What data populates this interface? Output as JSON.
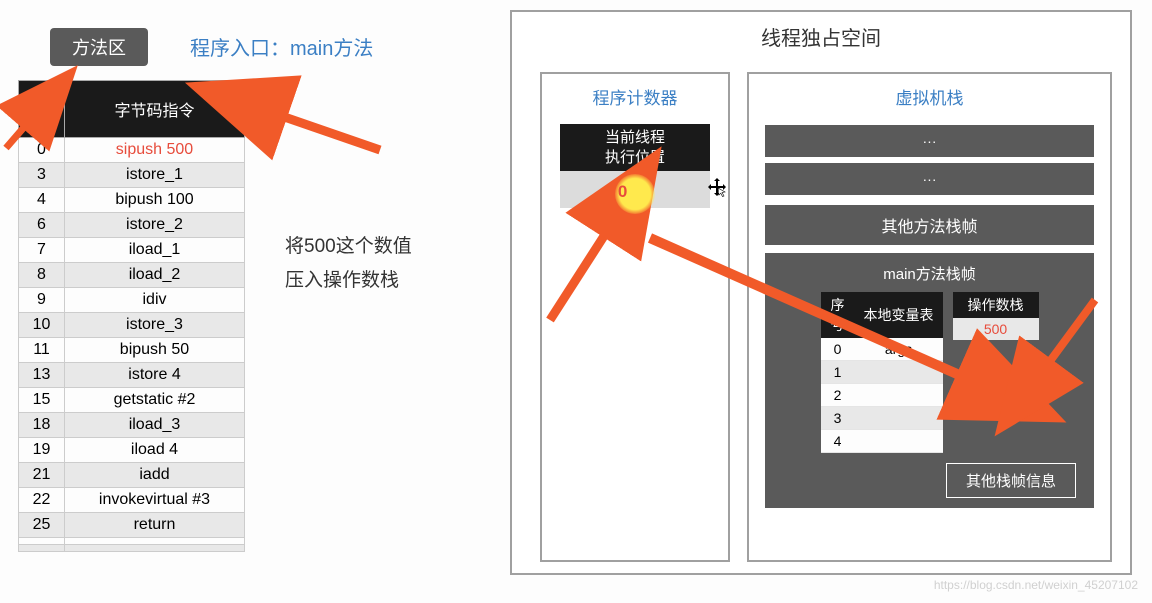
{
  "method_area_label": "方法区",
  "entry_label": "程序入口：main方法",
  "bytecode": {
    "headers": [
      "序号",
      "字节码指令"
    ],
    "rows": [
      {
        "idx": "0",
        "inst": "sipush 500",
        "highlight": true
      },
      {
        "idx": "3",
        "inst": "istore_1"
      },
      {
        "idx": "4",
        "inst": "bipush 100"
      },
      {
        "idx": "6",
        "inst": "istore_2"
      },
      {
        "idx": "7",
        "inst": "iload_1"
      },
      {
        "idx": "8",
        "inst": "iload_2"
      },
      {
        "idx": "9",
        "inst": "idiv"
      },
      {
        "idx": "10",
        "inst": "istore_3"
      },
      {
        "idx": "11",
        "inst": "bipush 50"
      },
      {
        "idx": "13",
        "inst": "istore 4"
      },
      {
        "idx": "15",
        "inst": "getstatic #2"
      },
      {
        "idx": "18",
        "inst": "iload_3"
      },
      {
        "idx": "19",
        "inst": "iload 4"
      },
      {
        "idx": "21",
        "inst": "iadd"
      },
      {
        "idx": "22",
        "inst": "invokevirtual #3"
      },
      {
        "idx": "25",
        "inst": "return"
      },
      {
        "idx": "",
        "inst": ""
      },
      {
        "idx": "",
        "inst": ""
      }
    ]
  },
  "annotation_line1": "将500这个数值",
  "annotation_line2": "压入操作数栈",
  "thread_title": "线程独占空间",
  "pc": {
    "title": "程序计数器",
    "label_line1": "当前线程",
    "label_line2": "执行位置",
    "value": "0"
  },
  "vm": {
    "title": "虚拟机栈",
    "ellipsis": "···",
    "other_frame": "其他方法栈帧",
    "main_frame_title": "main方法栈帧",
    "local_vars": {
      "headers": [
        "序号",
        "本地变量表"
      ],
      "rows": [
        {
          "idx": "0",
          "val": "args"
        },
        {
          "idx": "1",
          "val": ""
        },
        {
          "idx": "2",
          "val": ""
        },
        {
          "idx": "3",
          "val": ""
        },
        {
          "idx": "4",
          "val": ""
        }
      ]
    },
    "op_stack": {
      "header": "操作数栈",
      "rows": [
        "500"
      ]
    },
    "other_info": "其他栈帧信息"
  },
  "watermark": "https://blog.csdn.net/weixin_45207102"
}
